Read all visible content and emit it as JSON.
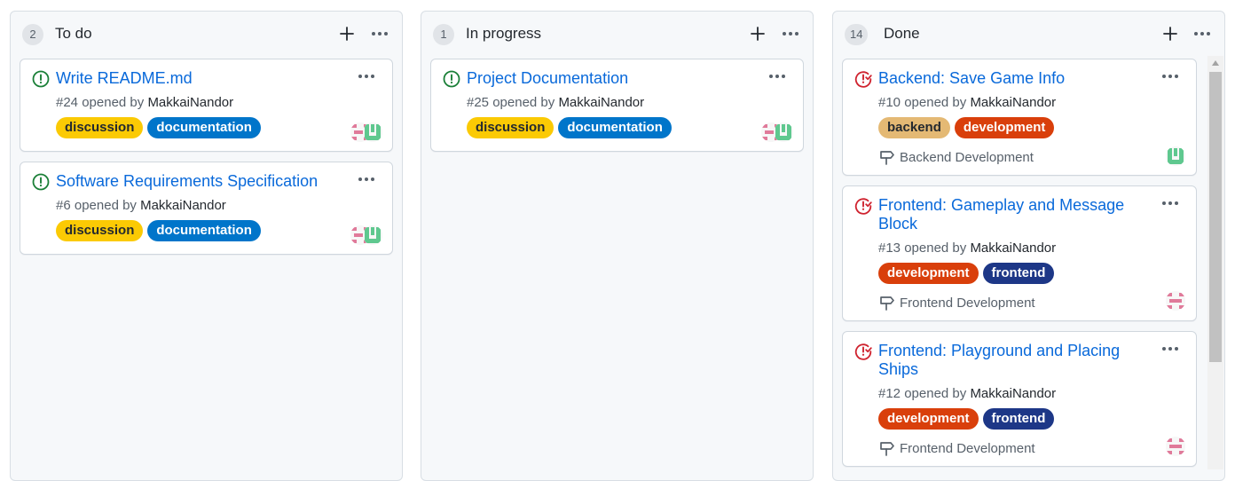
{
  "columns": [
    {
      "count": "2",
      "title": "To do",
      "cards": [
        {
          "title": "Write README.md",
          "meta_prefix": "#24 opened by ",
          "author": "MakkaiNandor",
          "labels": [
            "discussion",
            "documentation"
          ],
          "status": "open"
        },
        {
          "title": "Software Requirements Specification",
          "meta_prefix": "#6 opened by ",
          "author": "MakkaiNandor",
          "labels": [
            "discussion",
            "documentation"
          ],
          "status": "open"
        }
      ]
    },
    {
      "count": "1",
      "title": "In progress",
      "cards": [
        {
          "title": "Project Documentation",
          "meta_prefix": "#25 opened by ",
          "author": "MakkaiNandor",
          "labels": [
            "discussion",
            "documentation"
          ],
          "status": "open"
        }
      ]
    },
    {
      "count": "14",
      "title": "Done",
      "cards": [
        {
          "title": "Backend: Save Game Info",
          "meta_prefix": "#10 opened by ",
          "author": "MakkaiNandor",
          "labels": [
            "backend",
            "development"
          ],
          "milestone": "Backend Development",
          "status": "closed"
        },
        {
          "title": "Frontend: Gameplay and Message Block",
          "meta_prefix": "#13 opened by ",
          "author": "MakkaiNandor",
          "labels": [
            "development",
            "frontend"
          ],
          "milestone": "Frontend Development",
          "status": "closed"
        },
        {
          "title": "Frontend: Playground and Placing Ships",
          "meta_prefix": "#12 opened by ",
          "author": "MakkaiNandor",
          "labels": [
            "development",
            "frontend"
          ],
          "milestone": "Frontend Development",
          "status": "closed"
        }
      ]
    }
  ],
  "icons": {
    "open_issue": "issue-opened-icon",
    "closed_issue": "issue-closed-icon",
    "add": "plus-icon",
    "menu": "kebab-horizontal-icon",
    "milestone": "milestone-icon"
  },
  "colors": {
    "open_issue": "#1a7f37",
    "closed_issue": "#cf222e",
    "link": "#0969da",
    "discussion": "#fbca04",
    "documentation": "#0075ca",
    "backend": "#e4b974",
    "development": "#d93f0b",
    "frontend": "#1d3787"
  }
}
